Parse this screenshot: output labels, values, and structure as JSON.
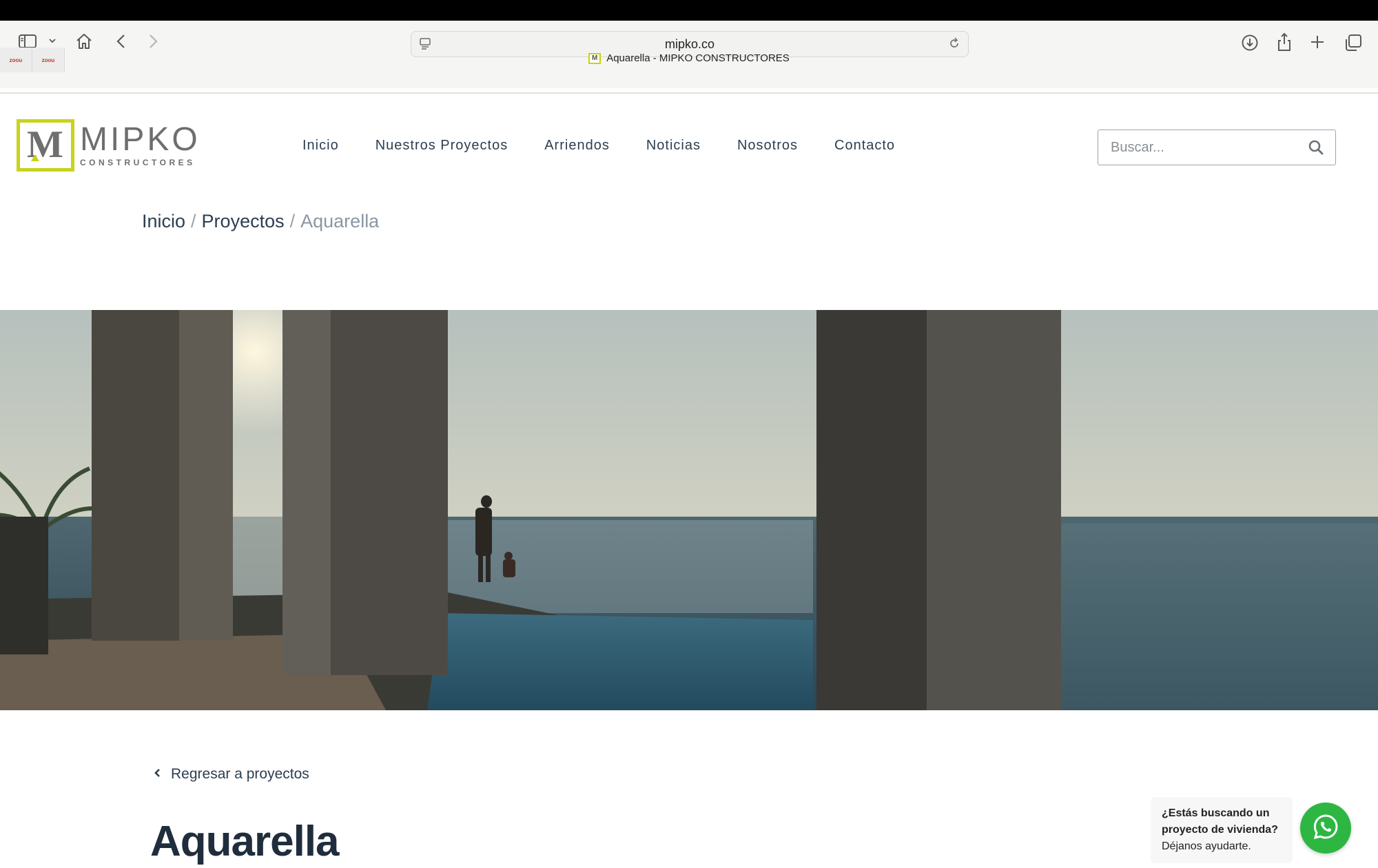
{
  "browser": {
    "url": "mipko.co",
    "tab_title": "Aquarella - MIPKO CONSTRUCTORES",
    "pinned_tabs": [
      "zoou",
      "zoou"
    ],
    "icons": [
      "sidebar-icon",
      "chevron-down-icon",
      "home-icon",
      "back-icon",
      "forward-icon",
      "reader-icon",
      "reload-icon",
      "download-icon",
      "share-icon",
      "new-tab-icon",
      "tab-overview-icon"
    ]
  },
  "site": {
    "logo": {
      "name": "MIPKO",
      "sub": "CONSTRUCTORES",
      "mark": "M",
      "accent_color": "#c8d31c"
    },
    "nav": [
      {
        "label": "Inicio"
      },
      {
        "label": "Nuestros Proyectos"
      },
      {
        "label": "Arriendos"
      },
      {
        "label": "Noticias"
      },
      {
        "label": "Nosotros"
      },
      {
        "label": "Contacto"
      }
    ],
    "search": {
      "placeholder": "Buscar...",
      "value": ""
    }
  },
  "breadcrumb": {
    "items": [
      "Inicio",
      "Proyectos",
      "Aquarella"
    ],
    "separator": "/"
  },
  "content": {
    "back_label": "Regresar a proyectos",
    "project_title": "Aquarella"
  },
  "chat": {
    "line1": "¿Estás buscando un",
    "line2": "proyecto de vivienda?",
    "line3": "Déjanos ayudarte.",
    "button_color": "#2db742"
  }
}
